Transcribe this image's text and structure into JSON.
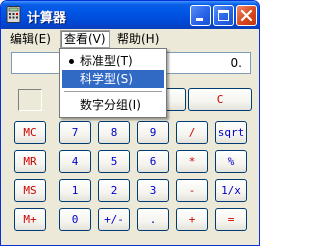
{
  "window": {
    "title": "计算器"
  },
  "menubar": {
    "edit": "编辑(E)",
    "view": "查看(V)",
    "help": "帮助(H)"
  },
  "view_menu": {
    "items": [
      {
        "label": "标准型(T)",
        "checked": true
      },
      {
        "label": "科学型(S)",
        "highlighted": true
      },
      {
        "label": "数字分组(I)"
      }
    ]
  },
  "display": {
    "value": "0."
  },
  "buttons": {
    "clear": "C",
    "mc": "MC",
    "mr": "MR",
    "ms": "MS",
    "mplus": "M+",
    "seven": "7",
    "eight": "8",
    "nine": "9",
    "divide": "/",
    "sqrt": "sqrt",
    "four": "4",
    "five": "5",
    "six": "6",
    "multiply": "*",
    "percent": "%",
    "one": "1",
    "two": "2",
    "three": "3",
    "minus": "-",
    "reciprocal": "1/x",
    "zero": "0",
    "sign": "+/-",
    "decimal": ".",
    "plus": "+",
    "equals": "="
  },
  "colors": {
    "titlebar": "#0055e5",
    "blue_label": "#0000cc",
    "red_label": "#cc0000",
    "menu_highlight": "#316ac5"
  },
  "icons": {
    "app": "calculator-icon",
    "minimize": "minimize-icon",
    "maximize": "maximize-icon",
    "close": "close-icon"
  }
}
